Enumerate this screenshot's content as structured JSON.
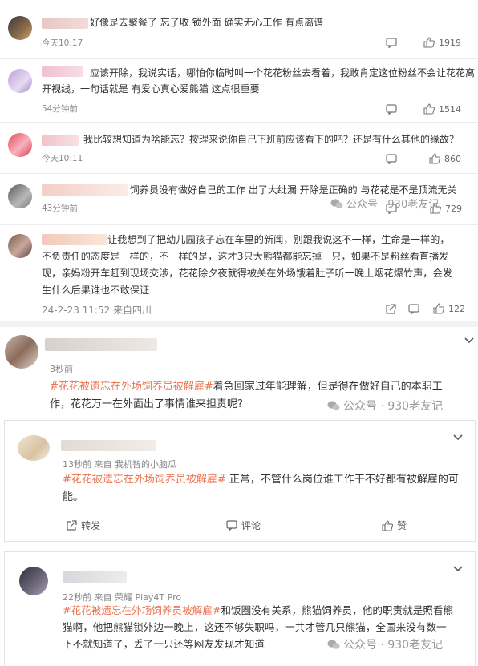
{
  "comments": [
    {
      "text": "好像是去聚餐了 忘了收 锁外面 确实无心工作 有点离谱",
      "time": "今天10:17",
      "likes": "1919"
    },
    {
      "text1": "应该开除，我说实话，哪怕你临时叫一个花花粉丝去看着，我敢肯定这位粉丝不会让花花离",
      "text2": "开视线，一句话就是 有爱心真心爱熊猫 这点很重要",
      "time": "54分钟前",
      "likes": "1514"
    },
    {
      "text": "我比较想知道为啥能忘？按理来说你自己下班前应该看下的吧？还是有什么其他的缘故？",
      "time": "今天10:11",
      "likes": "860"
    },
    {
      "text": "饲养员没有做好自己的工作 出了大纰漏 开除是正确的 与花花是不是顶流无关",
      "time": "43分钟前",
      "likes": "729"
    },
    {
      "text1": "让我想到了把幼儿园孩子忘在车里的新闻，别跟我说这不一样，生命是一样的，",
      "text2": "不负责任的态度是一样的，不一样的是，这才3只大熊猫都能忘掉一只，如果不是粉丝看直播发",
      "text3": "现，亲妈粉开车赶到现场交涉，花花除夕夜就得被关在外场饿着肚子听一晚上烟花爆竹声，会发",
      "text4": "生什么后果谁也不敢保证",
      "time": "24-2-23 11:52 来自四川",
      "likes": "122"
    }
  ],
  "post": {
    "time": "3秒前",
    "hashtag": "#花花被遗忘在外场饲养员被解雇#",
    "text1_rest": "着急回家过年能理解，但是得在做好自己的本职工",
    "text2": "作，花花万一在外面出了事情谁来担责呢?"
  },
  "card1": {
    "meta": "13秒前  来自 我机智的小脑瓜",
    "hashtag": "#花花被遗忘在外场饲养员被解雇#",
    "text1_rest": " 正常，不管什么岗位谁工作干不好都有被解雇的可",
    "text2": "能。",
    "repost": "转发",
    "comment": "评论",
    "like": "赞"
  },
  "card2": {
    "meta": "22秒前  来自 荣耀 Play4T Pro",
    "hashtag": "#花花被遗忘在外场饲养员被解雇#",
    "text1_rest": "和饭圈没有关系，熊猫饲养员，他的职责就是照看熊",
    "text2": "猫啊，他把熊猫锁外边一晚上，这还不够失职吗，一共才管几只熊猫，全国来没有数一",
    "text3": "下不就知道了，丢了一只还等网友发现才知道"
  },
  "watermark": "公众号 · 930老友记",
  "colors": {
    "hashtag": "#eb7350",
    "text": "#333333",
    "meta": "#888888"
  }
}
